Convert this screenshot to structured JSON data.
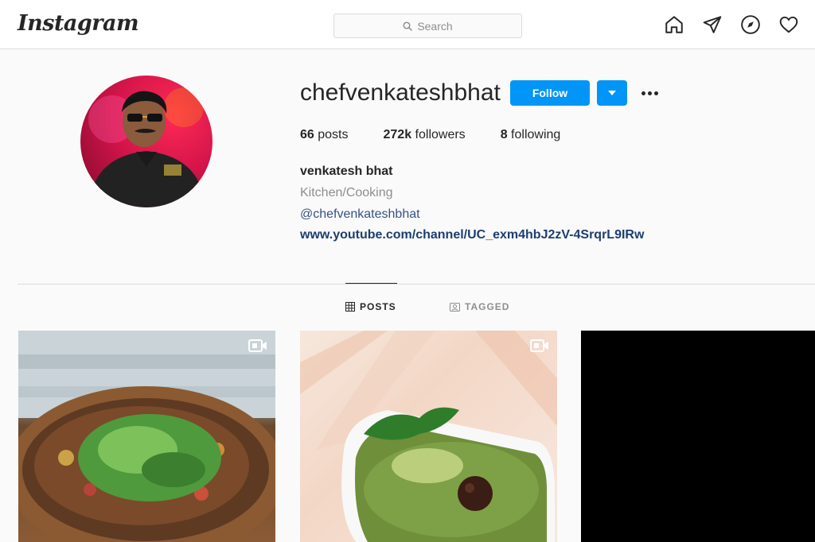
{
  "app": {
    "logo_text": "Instagram"
  },
  "search": {
    "placeholder": "Search"
  },
  "nav": {
    "icons": [
      "home-icon",
      "direct-message-icon",
      "explore-icon",
      "activity-heart-icon"
    ]
  },
  "profile": {
    "username": "chefvenkateshbhat",
    "follow_label": "Follow",
    "stats": {
      "posts_count": "66",
      "posts_label": "posts",
      "followers_count": "272k",
      "followers_label": "followers",
      "following_count": "8",
      "following_label": "following"
    },
    "full_name": "venkatesh bhat",
    "category": "Kitchen/Cooking",
    "handle": "@chefvenkateshbhat",
    "website": "www.youtube.com/channel/UC_exm4hbJ2zV-4SrqrL9IRw"
  },
  "tabs": [
    {
      "label": "POSTS",
      "icon": "grid-icon",
      "active": true
    },
    {
      "label": "TAGGED",
      "icon": "tagged-icon",
      "active": false
    }
  ],
  "posts": [
    {
      "type": "video",
      "icon": "video-icon"
    },
    {
      "type": "video",
      "icon": "video-icon"
    },
    {
      "type": "image"
    }
  ],
  "colors": {
    "accent": "#0095f6",
    "link": "#385185",
    "website": "#1c3e6f",
    "border": "#dbdbdb",
    "muted": "#8e8e8e"
  }
}
